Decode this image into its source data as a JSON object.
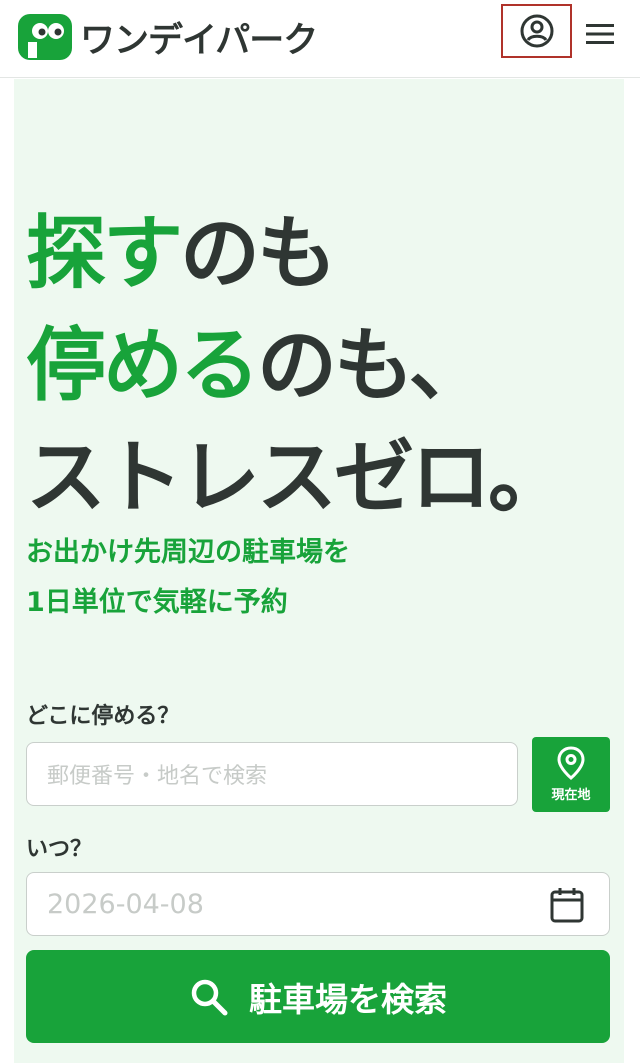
{
  "header": {
    "logo_text": "ワンデイパーク",
    "brand_color": "#18a33a"
  },
  "hero": {
    "headline": {
      "line1_green": "探す",
      "line1_rest": "のも",
      "line2_green": "停める",
      "line2_rest": "のも、",
      "line3": "ストレスゼロ。"
    },
    "sub_line1": "お出かけ先周辺の駐車場を",
    "sub_line2": "1日単位で気軽に予約"
  },
  "form": {
    "where_label": "どこに停める？",
    "where_placeholder": "郵便番号・地名で検索",
    "geo_label": "現在地",
    "when_label": "いつ？",
    "date_value": "2026-04-08",
    "search_label": "駐車場を検索"
  },
  "icons": {
    "account": "user-circle-icon",
    "menu": "hamburger-icon",
    "location": "map-pin-icon",
    "calendar": "calendar-icon",
    "search": "search-icon"
  }
}
